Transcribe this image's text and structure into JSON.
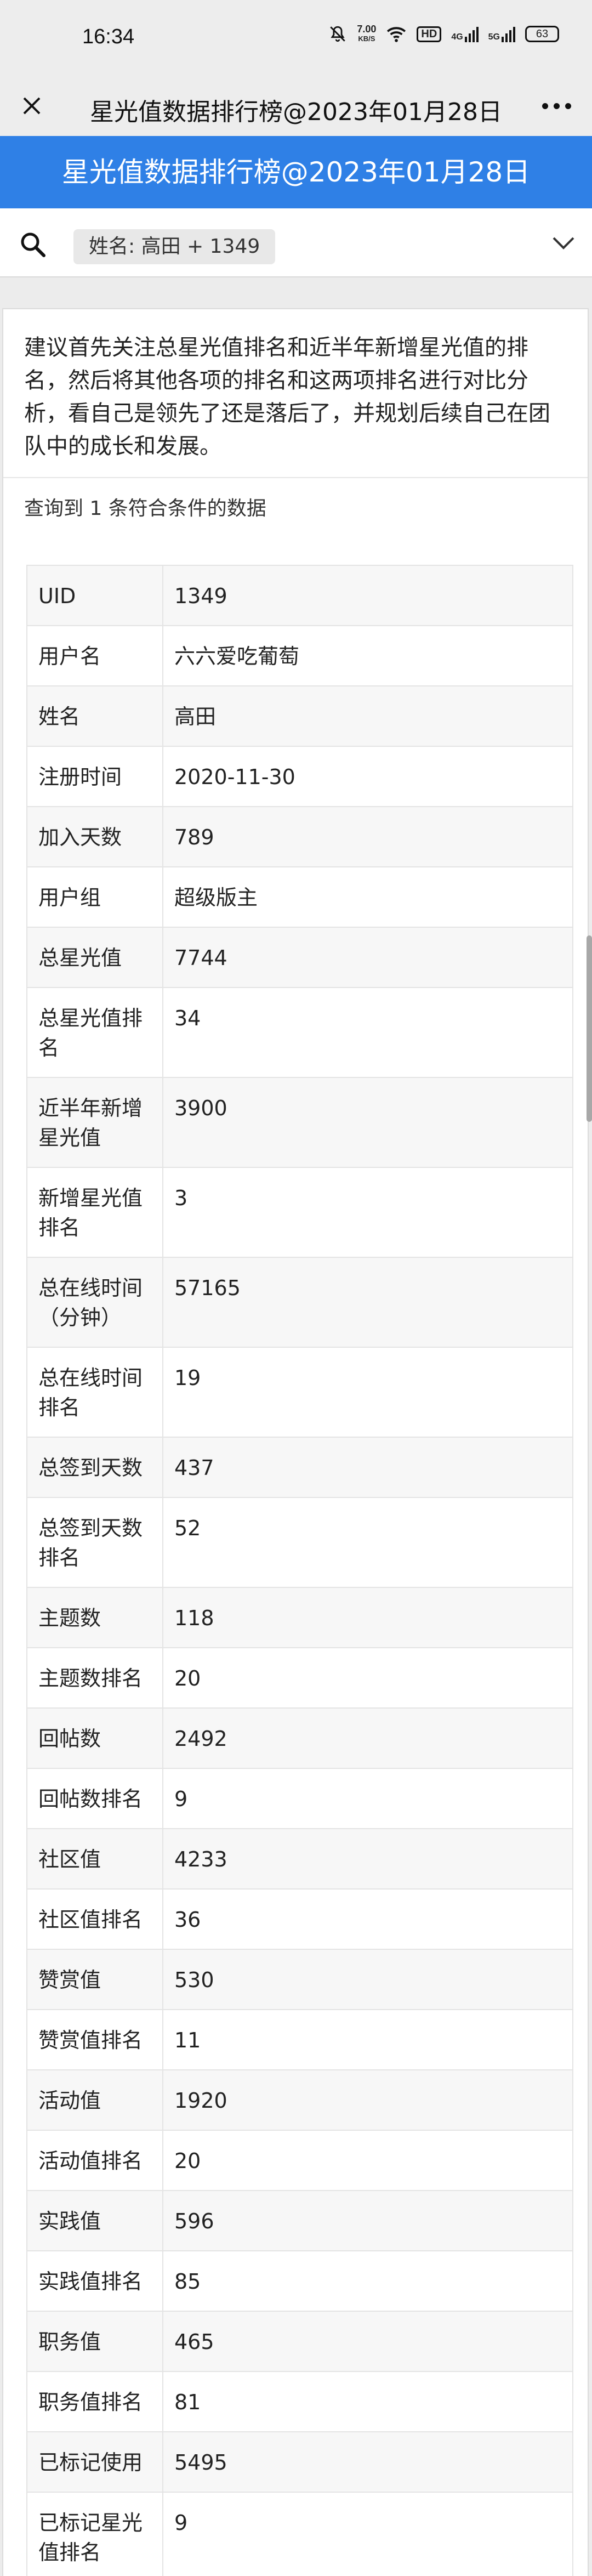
{
  "status_bar": {
    "time": "16:34",
    "net_speed_value": "7.00",
    "net_speed_unit": "KB/S",
    "hd_label": "HD",
    "signal1_label": "4G",
    "signal2_label": "5G",
    "battery": "63",
    "icons": [
      "mute-bell-icon",
      "wifi-icon",
      "hd-icon",
      "signal-4g-icon",
      "signal-5g-icon",
      "battery-icon"
    ]
  },
  "app_bar": {
    "title": "星光值数据排行榜@2023年01月28日",
    "close_icon": "close-icon",
    "more_icon": "more-icon"
  },
  "page_header": {
    "title": "星光值数据排行榜@2023年01月28日",
    "background": "#2f80e6"
  },
  "search": {
    "icon": "search-icon",
    "chip_label": "姓名: 高田 + 1349",
    "dropdown_icon": "chevron-down-icon"
  },
  "content": {
    "advice": "建议首先关注总星光值排名和近半年新增星光值的排名，然后将其他各项的排名和这两项排名进行对比分析，看自己是领先了还是落后了，并规划后续自己在团队中的成长和发展。",
    "result_text": "查询到 1 条符合条件的数据"
  },
  "table": {
    "rows": [
      {
        "label": "UID",
        "value": "1349"
      },
      {
        "label": "用户名",
        "value": "六六爱吃葡萄"
      },
      {
        "label": "姓名",
        "value": "高田"
      },
      {
        "label": "注册时间",
        "value": "2020-11-30"
      },
      {
        "label": "加入天数",
        "value": "789"
      },
      {
        "label": "用户组",
        "value": "超级版主"
      },
      {
        "label": "总星光值",
        "value": "7744"
      },
      {
        "label": "总星光值排名",
        "value": "34"
      },
      {
        "label": "近半年新增星光值",
        "value": "3900"
      },
      {
        "label": "新增星光值排名",
        "value": "3"
      },
      {
        "label": "总在线时间（分钟）",
        "value": "57165"
      },
      {
        "label": "总在线时间排名",
        "value": "19"
      },
      {
        "label": "总签到天数",
        "value": "437"
      },
      {
        "label": "总签到天数排名",
        "value": "52"
      },
      {
        "label": "主题数",
        "value": "118"
      },
      {
        "label": "主题数排名",
        "value": "20"
      },
      {
        "label": "回帖数",
        "value": "2492"
      },
      {
        "label": "回帖数排名",
        "value": "9"
      },
      {
        "label": "社区值",
        "value": "4233"
      },
      {
        "label": "社区值排名",
        "value": "36"
      },
      {
        "label": "赞赏值",
        "value": "530"
      },
      {
        "label": "赞赏值排名",
        "value": "11"
      },
      {
        "label": "活动值",
        "value": "1920"
      },
      {
        "label": "活动值排名",
        "value": "20"
      },
      {
        "label": "实践值",
        "value": "596"
      },
      {
        "label": "实践值排名",
        "value": "85"
      },
      {
        "label": "职务值",
        "value": "465"
      },
      {
        "label": "职务值排名",
        "value": "81"
      },
      {
        "label": "已标记使用",
        "value": "5495"
      },
      {
        "label": "已标记星光值排名",
        "value": "9"
      }
    ]
  }
}
